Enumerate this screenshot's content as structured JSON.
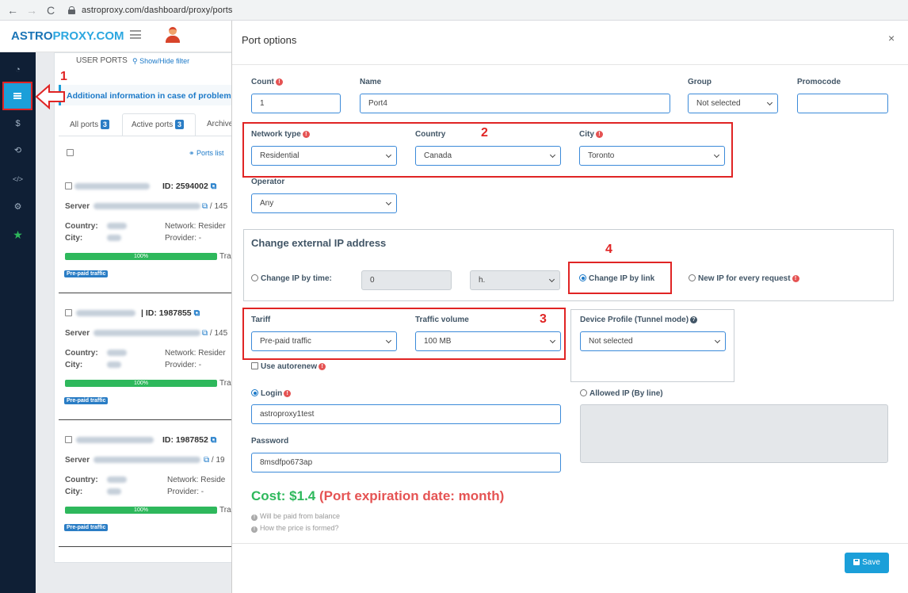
{
  "browser": {
    "back": "←",
    "forward": "→",
    "reload": "C",
    "url": "astroproxy.com/dashboard/proxy/ports"
  },
  "header": {
    "logo_a": "ASTRO",
    "logo_b": "PROXY.COM"
  },
  "sidebar": {
    "icons": [
      "dashboard-icon",
      "list-icon",
      "dollar-icon",
      "handshake-icon",
      "code-icon",
      "settings-icon",
      "star-icon"
    ],
    "glyphs": {
      "dashboard": "◔",
      "dollar": "$",
      "handshake": "⟲",
      "code": "</>",
      "settings": "⚙",
      "star": "★"
    }
  },
  "background": {
    "section_title": "USER PORTS",
    "filter_link": "Show/Hide filter",
    "info_text": "Additional information in case of problem",
    "tabs": [
      {
        "label": "All ports",
        "count": "3"
      },
      {
        "label": "Active ports",
        "count": "3"
      },
      {
        "label": "Archive"
      }
    ],
    "ports_list": "Ports list",
    "ports": [
      {
        "id": "ID: 2594002",
        "server": "Server",
        "server_suffix": "/ 145",
        "network": "Network: Resider",
        "provider": "Provider: -",
        "progress": "100%",
        "traffic": "Tra",
        "badge": "Pre-paid traffic"
      },
      {
        "id": "ID: 1987855",
        "server": "Server",
        "server_suffix": "/ 145",
        "network": "Network: Resider",
        "provider": "Provider: -",
        "progress": "100%",
        "traffic": "Tra",
        "badge": "Pre-paid traffic"
      },
      {
        "id": "ID: 1987852",
        "server": "Server",
        "server_suffix": "/ 19",
        "network": "Network: Reside",
        "provider": "Provider: -",
        "progress": "100%",
        "traffic": "Tra",
        "badge": "Pre-paid traffic"
      }
    ],
    "country_label": "Country:",
    "city_label": "City:"
  },
  "annotations": {
    "n1": "1",
    "n2": "2",
    "n3": "3",
    "n4": "4"
  },
  "modal": {
    "title": "Port options",
    "close": "×",
    "count": {
      "label": "Count",
      "value": "1"
    },
    "name": {
      "label": "Name",
      "value": "Port4"
    },
    "group": {
      "label": "Group",
      "value": "Not selected"
    },
    "promocode": {
      "label": "Promocode",
      "value": ""
    },
    "network_type": {
      "label": "Network type",
      "value": "Residential"
    },
    "country": {
      "label": "Country",
      "value": "Canada"
    },
    "city": {
      "label": "City",
      "value": "Toronto"
    },
    "operator": {
      "label": "Operator",
      "value": "Any"
    },
    "change_ip": {
      "heading": "Change external IP address",
      "by_time": "Change IP by time:",
      "time_value": "0",
      "time_unit": "h.",
      "by_link": "Change IP by link",
      "every_request": "New IP for every request"
    },
    "tariff": {
      "label": "Tariff",
      "value": "Pre-paid traffic"
    },
    "traffic_volume": {
      "label": "Traffic volume",
      "value": "100 MB"
    },
    "device_profile": {
      "label": "Device Profile (Tunnel mode)",
      "value": "Not selected"
    },
    "autorenew": "Use autorenew",
    "login": {
      "label": "Login",
      "value": "astroproxy1test"
    },
    "allowed_ip": {
      "label": "Allowed IP (By line)"
    },
    "password": {
      "label": "Password",
      "value": "8msdfpo673ap"
    },
    "cost": {
      "amount": "Cost: $1.4",
      "expiration": "(Port expiration date: month)"
    },
    "notes": [
      "Will be paid from balance",
      "How the price is formed?"
    ],
    "save": "Save"
  },
  "colors": {
    "accent": "#1b9fd9",
    "annotation": "#e02424",
    "cost_green": "#2eb85c",
    "cost_red": "#e55353",
    "sidebar": "#0f1f35"
  }
}
